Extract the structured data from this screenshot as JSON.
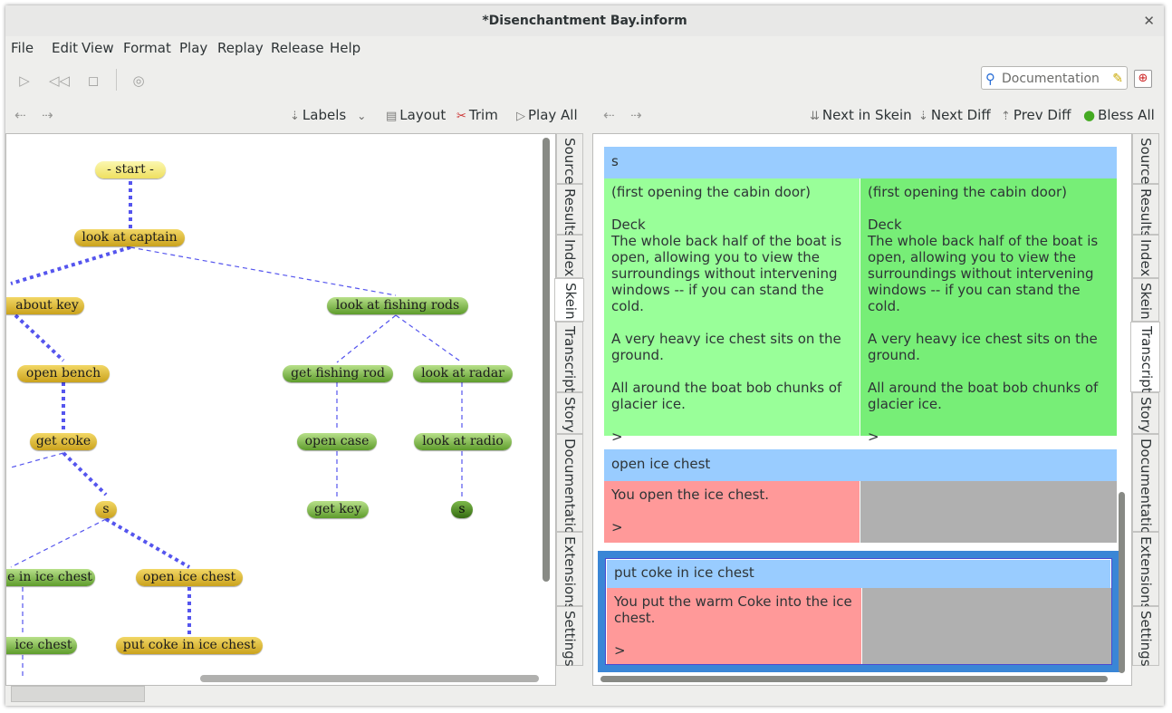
{
  "window": {
    "title": "*Disenchantment Bay.inform"
  },
  "menu": [
    "File",
    "Edit",
    "View",
    "Format",
    "Play",
    "Replay",
    "Release",
    "Help"
  ],
  "search": {
    "placeholder": "Documentation"
  },
  "skein_toolbar": {
    "labels": "Labels",
    "layout": "Layout",
    "trim": "Trim",
    "play_all": "Play All"
  },
  "transcript_toolbar": {
    "next_in_skein": "Next in Skein",
    "next_diff": "Next Diff",
    "prev_diff": "Prev Diff",
    "bless_all": "Bless All"
  },
  "tabs": [
    "Source",
    "Results",
    "Index",
    "Skein",
    "Transcript",
    "Story",
    "Documentation",
    "Extensions",
    "Settings"
  ],
  "left_active_tab": "Skein",
  "right_active_tab": "Transcript",
  "skein_nodes": [
    {
      "label": "- start -",
      "color": "yellow"
    },
    {
      "label": "look at captain",
      "color": "gold"
    },
    {
      "label": "about key",
      "color": "gold"
    },
    {
      "label": "look at fishing rods",
      "color": "green"
    },
    {
      "label": "open bench",
      "color": "gold"
    },
    {
      "label": "get fishing rod",
      "color": "green"
    },
    {
      "label": "look at radar",
      "color": "green"
    },
    {
      "label": "get coke",
      "color": "gold"
    },
    {
      "label": "open case",
      "color": "green"
    },
    {
      "label": "look at radio",
      "color": "green"
    },
    {
      "label": "s",
      "color": "gold"
    },
    {
      "label": "get key",
      "color": "green"
    },
    {
      "label": "s",
      "color": "dark-green"
    },
    {
      "label": "e in ice chest",
      "color": "green"
    },
    {
      "label": "open ice chest",
      "color": "gold"
    },
    {
      "label": "ice chest",
      "color": "green"
    },
    {
      "label": "put coke in ice chest",
      "color": "gold"
    }
  ],
  "transcript": [
    {
      "command": "s",
      "actual": "(first opening the cabin door)\n\nDeck\nThe whole back half of the boat is\nopen, allowing you to view the\nsurroundings without intervening\nwindows -- if you can stand the cold.\n\nA very heavy ice chest sits on the\nground.\n\nAll around the boat bob chunks of\nglacier ice.\n\n>",
      "expected": "(first opening the cabin door)\n\nDeck\nThe whole back half of the boat is\nopen, allowing you to view the\nsurroundings without intervening\nwindows -- if you can stand the cold.\n\nA very heavy ice chest sits on the\nground.\n\nAll around the boat bob chunks of\nglacier ice.\n\n>",
      "status": "match"
    },
    {
      "command": "open ice chest",
      "actual": "You open the ice chest.\n\n>",
      "expected": "",
      "status": "no-blessed"
    },
    {
      "command": "put coke in ice chest",
      "actual": "You put the warm Coke into the ice\nchest.\n\n>",
      "expected": "",
      "status": "no-blessed"
    }
  ],
  "colors": {
    "header": "#99ccff",
    "match_left": "#99ff99",
    "match_right": "#77ee77",
    "mismatch": "#ff9999",
    "empty": "#b0b0b0",
    "selection": "#3a86d6"
  }
}
